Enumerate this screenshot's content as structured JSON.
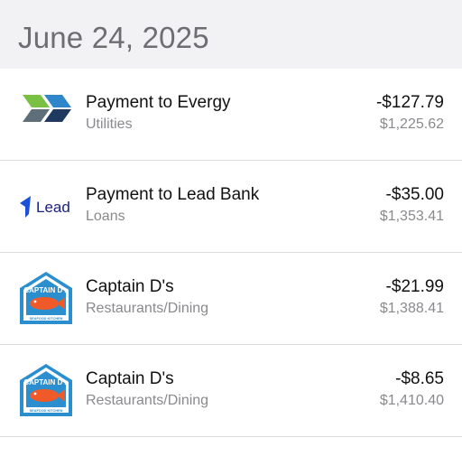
{
  "header": {
    "date": "June 24, 2025"
  },
  "transactions": [
    {
      "logo_icon": "evergy-logo-icon",
      "title": "Payment to Evergy",
      "category": "Utilities",
      "amount": "-$127.79",
      "balance": "$1,225.62"
    },
    {
      "logo_icon": "lead-bank-logo-icon",
      "logo_text": "Lead",
      "title": "Payment to Lead Bank",
      "category": "Loans",
      "amount": "-$35.00",
      "balance": "$1,353.41"
    },
    {
      "logo_icon": "captain-ds-logo-icon",
      "logo_text": "CAPTAIN D's",
      "logo_subtext": "SEAFOOD KITCHEN",
      "title": "Captain D's",
      "category": "Restaurants/Dining",
      "amount": "-$21.99",
      "balance": "$1,388.41"
    },
    {
      "logo_icon": "captain-ds-logo-icon",
      "logo_text": "CAPTAIN D's",
      "logo_subtext": "SEAFOOD KITCHEN",
      "title": "Captain D's",
      "category": "Restaurants/Dining",
      "amount": "-$8.65",
      "balance": "$1,410.40"
    }
  ],
  "colors": {
    "header_bg": "#f2f2f4",
    "primary_text": "#111111",
    "secondary_text": "#8a8a8e",
    "evergy_green": "#7ac143",
    "evergy_blue": "#2f86c8",
    "evergy_gray": "#5f6f7a",
    "evergy_navy": "#1f3a5f",
    "lead_blue": "#1e4fd8",
    "captain_blue": "#2b8fcf",
    "captain_orange": "#f05a28"
  }
}
